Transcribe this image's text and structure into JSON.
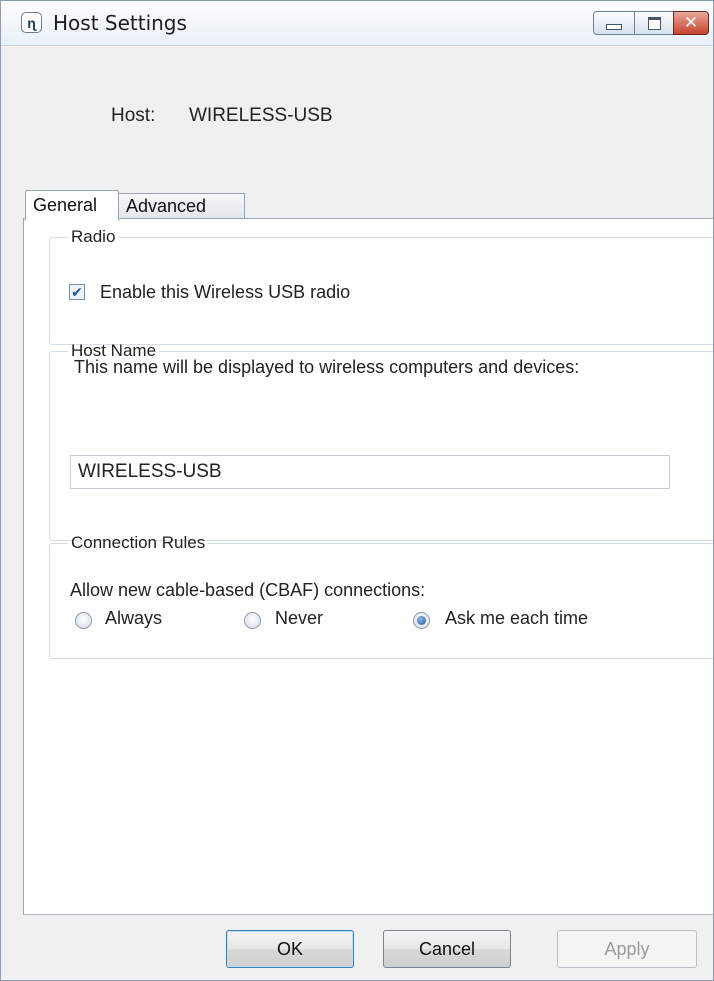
{
  "window": {
    "title": "Host Settings",
    "icon": "wireless-usb-icon",
    "buttons": {
      "minimize": "minimize-icon",
      "maximize": "maximize-icon",
      "close": "close-icon"
    }
  },
  "host": {
    "label": "Host:",
    "value": "WIRELESS-USB"
  },
  "tabs": [
    {
      "label": "General",
      "active": true
    },
    {
      "label": "Advanced",
      "active": false
    }
  ],
  "radio_group": {
    "legend": "Radio",
    "checkbox_label": "Enable this Wireless USB radio",
    "checked": true
  },
  "host_name_group": {
    "legend": "Host Name",
    "description": "This name will be displayed to wireless computers and devices:",
    "input_value": "WIRELESS-USB"
  },
  "connection_rules_group": {
    "legend": "Connection Rules",
    "description": "Allow new cable-based (CBAF) connections:",
    "options": [
      {
        "label": "Always",
        "selected": false
      },
      {
        "label": "Never",
        "selected": false
      },
      {
        "label": "Ask me each time",
        "selected": true
      }
    ]
  },
  "footer": {
    "ok": "OK",
    "cancel": "Cancel",
    "apply": "Apply",
    "apply_enabled": false
  }
}
